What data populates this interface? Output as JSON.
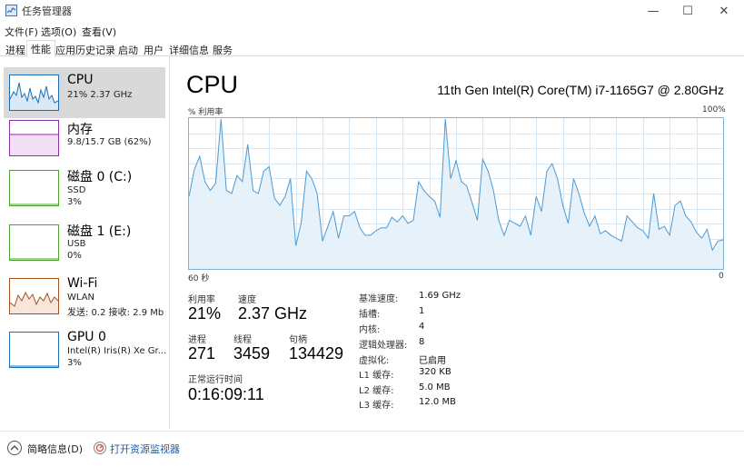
{
  "window": {
    "title": "任务管理器",
    "minimize": "—",
    "maximize": "☐",
    "close": "✕"
  },
  "menu": {
    "file": "文件(F)",
    "options": "选项(O)",
    "view": "查看(V)"
  },
  "tabs": [
    {
      "label": "进程"
    },
    {
      "label": "性能"
    },
    {
      "label": "应用历史记录"
    },
    {
      "label": "启动"
    },
    {
      "label": "用户"
    },
    {
      "label": "详细信息"
    },
    {
      "label": "服务"
    }
  ],
  "sidebar": {
    "items": [
      {
        "name": "CPU",
        "line1": "21% 2.37 GHz",
        "line2": "",
        "color": "#1a6fb4"
      },
      {
        "name": "内存",
        "line1": "9.8/15.7 GB (62%)",
        "line2": "",
        "color": "#8b2fa8"
      },
      {
        "name": "磁盘 0 (C:)",
        "line1": "SSD",
        "line2": "3%",
        "color": "#4da52e"
      },
      {
        "name": "磁盘 1 (E:)",
        "line1": "USB",
        "line2": "0%",
        "color": "#4da52e"
      },
      {
        "name": "Wi-Fi",
        "line1": "WLAN",
        "line2": "发送: 0.2  接收: 2.9 Mb",
        "color": "#a7521e"
      },
      {
        "name": "GPU 0",
        "line1": "Intel(R) Iris(R) Xe Gr...",
        "line2": "3%",
        "color": "#1a6fb4"
      }
    ]
  },
  "main": {
    "title": "CPU",
    "model": "11th Gen Intel(R) Core(TM) i7-1165G7 @ 2.80GHz",
    "graph_label": "% 利用率",
    "graph_max": "100%",
    "graph_left": "60 秒",
    "graph_right": "0",
    "stats": {
      "util_label": "利用率",
      "util_value": "21%",
      "speed_label": "速度",
      "speed_value": "2.37 GHz",
      "proc_label": "进程",
      "proc_value": "271",
      "thread_label": "线程",
      "thread_value": "3459",
      "handle_label": "句柄",
      "handle_value": "134429",
      "uptime_label": "正常运行时间",
      "uptime_value": "0:16:09:11"
    },
    "specs": [
      {
        "label": "基准速度:",
        "value": "1.69 GHz"
      },
      {
        "label": "插槽:",
        "value": "1"
      },
      {
        "label": "内核:",
        "value": "4"
      },
      {
        "label": "逻辑处理器:",
        "value": "8"
      },
      {
        "label": "虚拟化:",
        "value": "已启用"
      },
      {
        "label": "L1 缓存:",
        "value": "320 KB"
      },
      {
        "label": "L2 缓存:",
        "value": "5.0 MB"
      },
      {
        "label": "L3 缓存:",
        "value": "12.0 MB"
      }
    ],
    "graph_color": "#4a9bd6",
    "graph_fill": "#e6f1fa",
    "cpu_history": [
      48,
      66,
      75,
      58,
      52,
      57,
      100,
      52,
      50,
      62,
      58,
      83,
      52,
      50,
      65,
      68,
      47,
      42,
      48,
      60,
      15,
      30,
      65,
      60,
      50,
      18,
      28,
      38,
      20,
      35,
      35,
      38,
      27,
      22,
      22,
      25,
      27,
      27,
      34,
      31,
      35,
      30,
      32,
      58,
      52,
      48,
      45,
      34,
      100,
      60,
      72,
      58,
      55,
      44,
      32,
      73,
      65,
      52,
      32,
      22,
      32,
      30,
      28,
      35,
      22,
      48,
      38,
      65,
      70,
      60,
      42,
      30,
      60,
      50,
      37,
      28,
      35,
      23,
      25,
      22,
      20,
      18,
      35,
      31,
      27,
      25,
      20,
      50,
      26,
      28,
      22,
      42,
      45,
      35,
      31,
      24,
      20,
      26,
      12,
      18,
      19
    ]
  },
  "footer": {
    "fewer_details": "简略信息(D)",
    "resource_monitor": "打开资源监视器"
  }
}
